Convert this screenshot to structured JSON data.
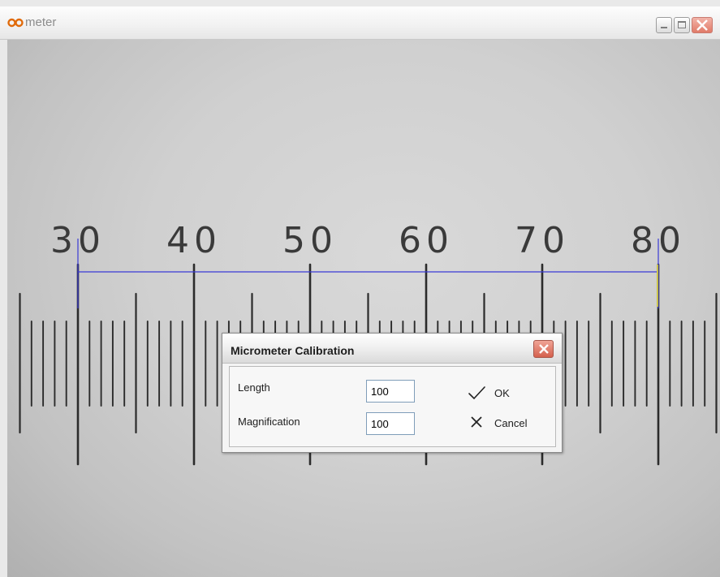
{
  "window": {
    "title": "meter",
    "icon": "glasses-icon",
    "controls": [
      "minimize-icon",
      "maximize-icon",
      "close-icon"
    ]
  },
  "micrometer": {
    "scale_numbers": [
      "30",
      "40",
      "50",
      "60",
      "70",
      "80"
    ]
  },
  "dialog": {
    "title": "Micrometer Calibration",
    "length_label": "Length",
    "length_value": "100",
    "magnification_label": "Magnification",
    "magnification_value": "100",
    "ok_label": "OK",
    "ok_icon": "checkmark-icon",
    "cancel_label": "Cancel",
    "cancel_icon": "x-icon"
  },
  "colors": {
    "measure_line": "#3a3ad6",
    "scale_marks": "#2b2b2b"
  }
}
